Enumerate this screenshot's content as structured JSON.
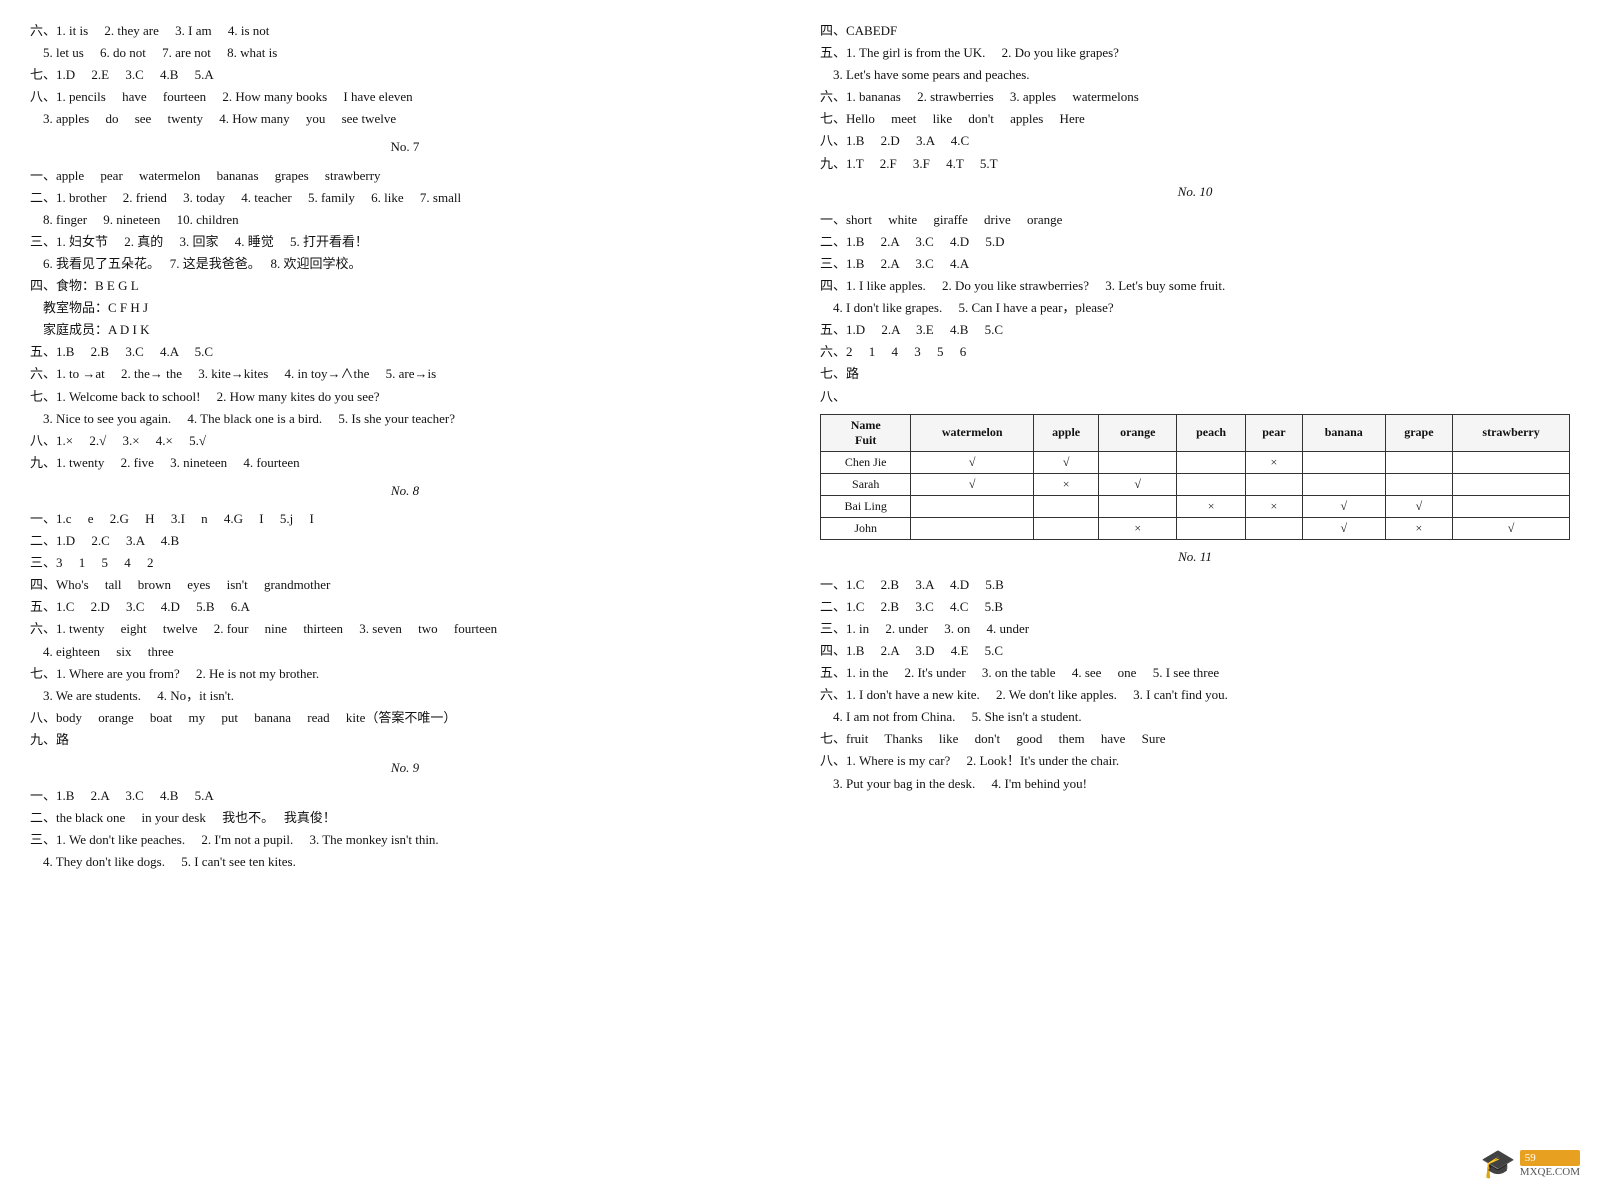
{
  "left": {
    "sections": [
      {
        "id": "liu6",
        "lines": [
          "六、1. it is   2. they are   3. I am   4. is not",
          "　5. let us   6. do not   7. are not   8. what is",
          "七、1.D   2.E   3.C   4.B   5.A",
          "八、1. pencils   have   fourteen   2. How many books   I have eleven",
          "　3. apples   do   see   twenty   4. How many   you   see twelve"
        ]
      },
      {
        "id": "no7",
        "center": "No. 7"
      },
      {
        "id": "no7content",
        "lines": [
          "一、apple   pear   watermelon   bananas   grapes   strawberry",
          "二、1. brother   2. friend   3. today   4. teacher   5. family   6. like   7. small",
          "　8. finger   9. nineteen   10. children",
          "三、1. 妇女节   2. 真的   3. 回家   4. 睡觉   5. 打开看看！",
          "　6. 我看见了五朵花。   7. 这是我爸爸。   8. 欢迎回学校。",
          "四、食物：B E G L",
          "　教室物品：C F H J",
          "　家庭成员：A D I K",
          "五、1.B   2.B   3.C   4.A   5.C",
          "六、1. to →at   2. the→ the   3. kite→kites   4. in toy→∧the   5. are→is",
          "七、1. Welcome back to school!   2. How many kites do you see?",
          "　3. Nice to see you again.   4. The black one is a bird.   5. Is she your teacher?",
          "八、1.×   2.√   3.×   4.×   5.√",
          "九、1. twenty   2. five   3. nineteen   4. fourteen"
        ]
      },
      {
        "id": "no8",
        "center": "No. 8"
      },
      {
        "id": "no8content",
        "lines": [
          "一、1.c   e   2.G   H   3.I   n   4.G   I   5.j   I",
          "二、1.D   2.C   3.A   4.B",
          "三、3   1   5   4   2",
          "四、Who's   tall   brown   eyes   isn't   grandmother",
          "五、1.C   2.D   3.C   4.D   5.B   6.A",
          "六、1. twenty   eight   twelve   2. four   nine   thirteen   3. seven   two   fourteen",
          "　4. eighteen   six   three",
          "七、1. Where are you from?   2. He is not my brother.",
          "　3. We are students.   4. No，it isn't.",
          "八、body   orange   boat   my   put   banana   read   kite（答案不唯一）",
          "九、路"
        ]
      },
      {
        "id": "no9",
        "center": "No. 9"
      },
      {
        "id": "no9content",
        "lines": [
          "一、1.B   2.A   3.C   4.B   5.A",
          "二、the black one   in your desk   我也不。   我真俊！",
          "三、1. We don't like peaches.   2. I'm not a pupil.   3. The monkey isn't thin.",
          "　4. They don't like dogs.   5. I can't see ten kites."
        ]
      }
    ]
  },
  "right": {
    "sections": [
      {
        "id": "si4",
        "lines": [
          "四、CABEDF",
          "五、1. The girl is from the UK.   2. Do you like grapes?",
          "　3. Let's have some pears and peaches.",
          "六、1. bananas   2. strawberries   3. apples   watermelons",
          "七、Hello   meet   like   don't   apples   Here",
          "八、1.B   2.D   3.A   4.C",
          "九、1.T   2.F   3.F   4.T   5.T"
        ]
      },
      {
        "id": "no10",
        "center": "No. 10"
      },
      {
        "id": "no10content",
        "lines": [
          "一、short   white   giraffe   drive   orange",
          "二、1.B   2.A   3.C   4.D   5.D",
          "三、1.B   2.A   3.C   4.A",
          "四、1. I like apples.   2. Do you like strawberries?   3. Let's buy some fruit.",
          "　4. I don't like grapes.   5. Can I have a pear，please?",
          "五、1.D   2.A   3.E   4.B   5.C",
          "六、2   1   4   3   5   6",
          "七、路",
          "八、"
        ]
      }
    ],
    "table": {
      "headers": [
        "Name Fuit",
        "watermelon",
        "apple",
        "orange",
        "peach",
        "pear",
        "banana",
        "grape",
        "strawberry"
      ],
      "rows": [
        {
          "name": "Chen Jie",
          "watermelon": "√",
          "apple": "√",
          "orange": "",
          "peach": "",
          "pear": "×",
          "banana": "",
          "grape": "",
          "strawberry": ""
        },
        {
          "name": "Sarah",
          "watermelon": "√",
          "apple": "×",
          "orange": "√",
          "peach": "",
          "pear": "",
          "banana": "",
          "grape": "",
          "strawberry": ""
        },
        {
          "name": "Bai Ling",
          "watermelon": "",
          "apple": "",
          "orange": "",
          "peach": "×",
          "pear": "×",
          "banana": "√",
          "grape": "√",
          "strawberry": ""
        },
        {
          "name": "John",
          "watermelon": "",
          "apple": "",
          "orange": "×",
          "peach": "",
          "pear": "",
          "banana": "√",
          "grape": "×",
          "strawberry": "√"
        }
      ]
    },
    "after_table": {
      "id": "no11",
      "center": "No. 11"
    },
    "no11content": {
      "lines": [
        "一、1.C   2.B   3.A   4.D   5.B",
        "二、1.C   2.B   3.C   4.C   5.B",
        "三、1. in   2. under   3. on   4. under",
        "四、1.B   2.A   3.D   4.E   5.C",
        "五、1. in the   2. It's under   3. on the table   4. see   one   5. I see three",
        "六、1. I don't have a new kite.   2. We don't like apples.   3. I can't find you.",
        "　4. I am not from China.   5. She isn't a student.",
        "七、fruit   Thanks   like   don't   good   them   have   Sure",
        "八、1. Where is my car?   2. Look！It's under the chair.",
        "　3. Put your bag in the desk.   4. I'm behind you!"
      ]
    }
  },
  "watermark": {
    "number": "59",
    "site": "MXQE.COM"
  }
}
